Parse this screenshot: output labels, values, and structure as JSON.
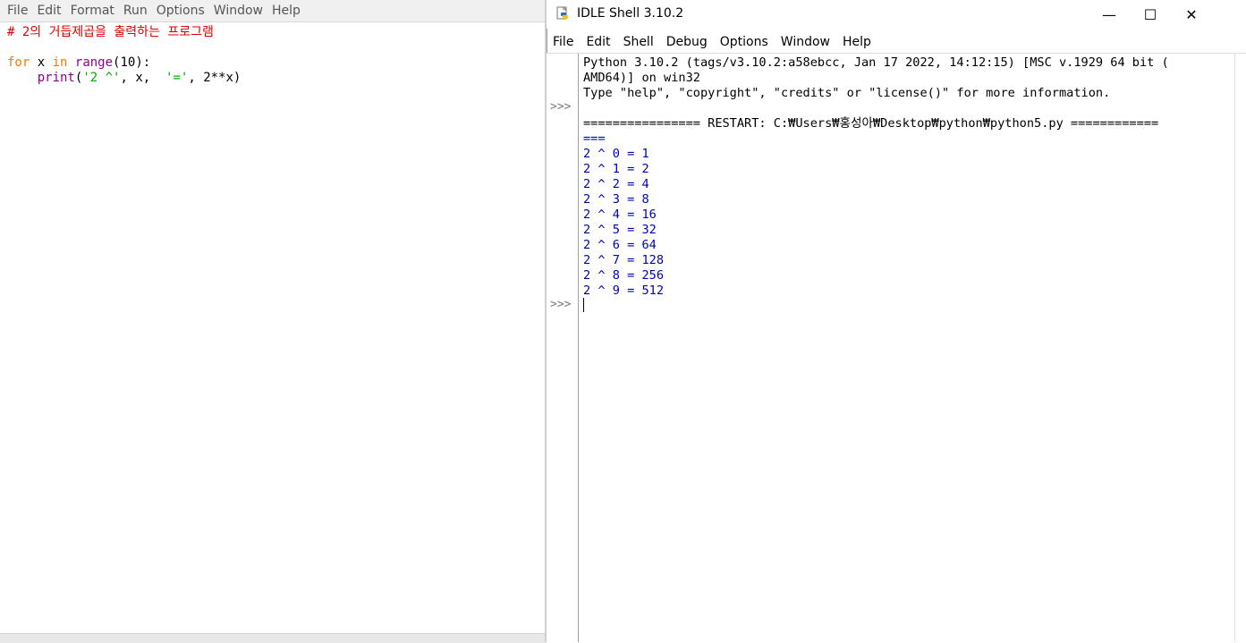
{
  "editor": {
    "menu": [
      "File",
      "Edit",
      "Format",
      "Run",
      "Options",
      "Window",
      "Help"
    ],
    "code": {
      "comment": "# 2의 거듭제곱을 출력하는 프로그램",
      "kw_for": "for",
      "loop_var": " x ",
      "kw_in": "in",
      "builtin_range": "range",
      "range_args": "(10):",
      "indent": "    ",
      "builtin_print": "print",
      "paren_open": "(",
      "str1": "'2 ^'",
      "mid": ", x,  ",
      "str2": "'='",
      "tail": ", 2**x)"
    }
  },
  "shell": {
    "title": "IDLE Shell 3.10.2",
    "window_controls": {
      "minimize": "—",
      "maximize": "☐",
      "close": "✕"
    },
    "menu": [
      "File",
      "Edit",
      "Shell",
      "Debug",
      "Options",
      "Window",
      "Help"
    ],
    "prompts": [
      ">>>",
      ">>>"
    ],
    "banner": [
      "Python 3.10.2 (tags/v3.10.2:a58ebcc, Jan 17 2022, 14:12:15) [MSC v.1929 64 bit (",
      "AMD64)] on win32",
      "Type \"help\", \"copyright\", \"credits\" or \"license()\" for more information."
    ],
    "restart": [
      "================ RESTART: C:₩Users₩홍성아₩Desktop₩python₩python5.py ============",
      "==="
    ],
    "output": [
      "2 ^ 0 = 1",
      "2 ^ 1 = 2",
      "2 ^ 2 = 4",
      "2 ^ 3 = 8",
      "2 ^ 4 = 16",
      "2 ^ 5 = 32",
      "2 ^ 6 = 64",
      "2 ^ 7 = 128",
      "2 ^ 8 = 256",
      "2 ^ 9 = 512"
    ]
  },
  "colors": {
    "comment": "#dd0000",
    "keyword": "#ff7700",
    "builtin": "#900090",
    "string": "#00aa00",
    "shell_output": "#0000bb"
  }
}
